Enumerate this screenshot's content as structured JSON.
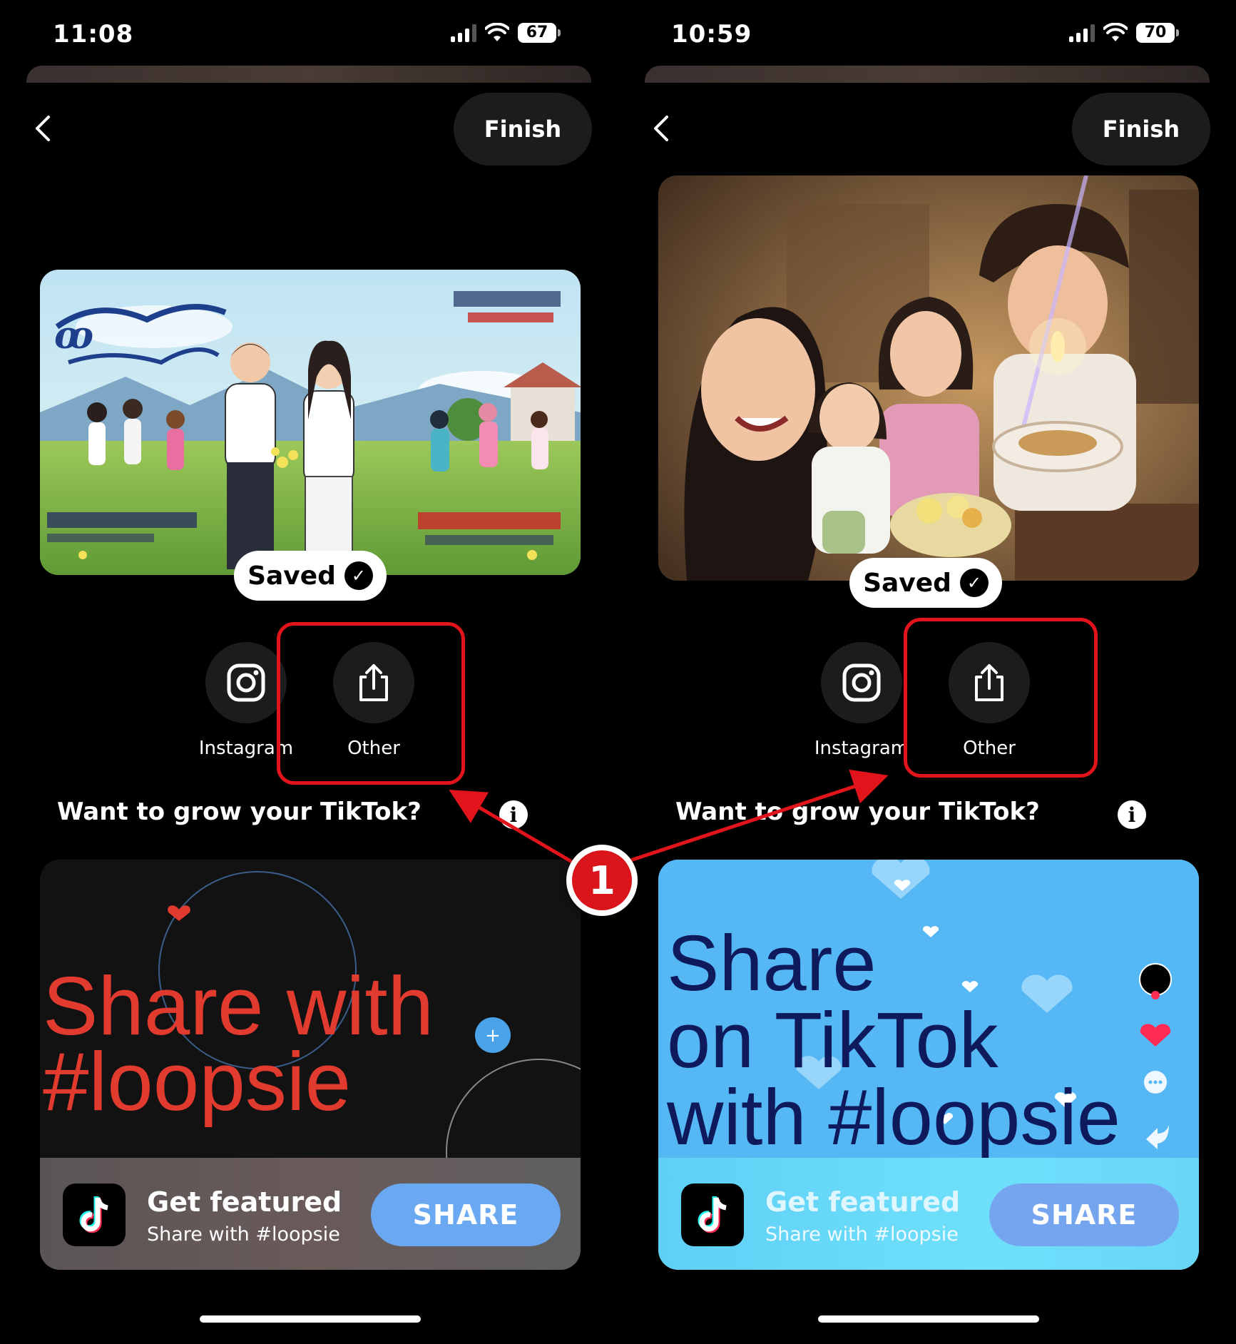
{
  "screens": [
    {
      "status": {
        "time": "11:08",
        "battery": "67"
      },
      "header": {
        "finish_label": "Finish"
      },
      "saved_label": "Saved",
      "share": {
        "instagram_label": "Instagram",
        "other_label": "Other"
      },
      "promo": {
        "heading": "Want to grow your TikTok?",
        "headline_line1": "Share with",
        "headline_line2": "#loopsie",
        "featured_title": "Get featured",
        "featured_sub": "Share with #loopsie",
        "cta_label": "SHARE"
      }
    },
    {
      "status": {
        "time": "10:59",
        "battery": "70"
      },
      "header": {
        "finish_label": "Finish"
      },
      "saved_label": "Saved",
      "share": {
        "instagram_label": "Instagram",
        "other_label": "Other"
      },
      "promo": {
        "heading": "Want to grow your TikTok?",
        "headline_line1": "Share",
        "headline_line2": "on TikTok",
        "headline_line3": "with #loopsie",
        "featured_title": "Get featured",
        "featured_sub": "Share with #loopsie",
        "cta_label": "SHARE"
      }
    }
  ],
  "annotation": {
    "step_number": "1"
  },
  "colors": {
    "highlight": "#e0141a",
    "accent_red": "#e13a2e",
    "button_blue": "#6aa8f2",
    "promo_blue": "#55b8f5"
  },
  "icons": [
    "back-chevron-icon",
    "instagram-icon",
    "share-export-icon",
    "info-icon",
    "tiktok-logo-icon",
    "checkmark-icon"
  ]
}
